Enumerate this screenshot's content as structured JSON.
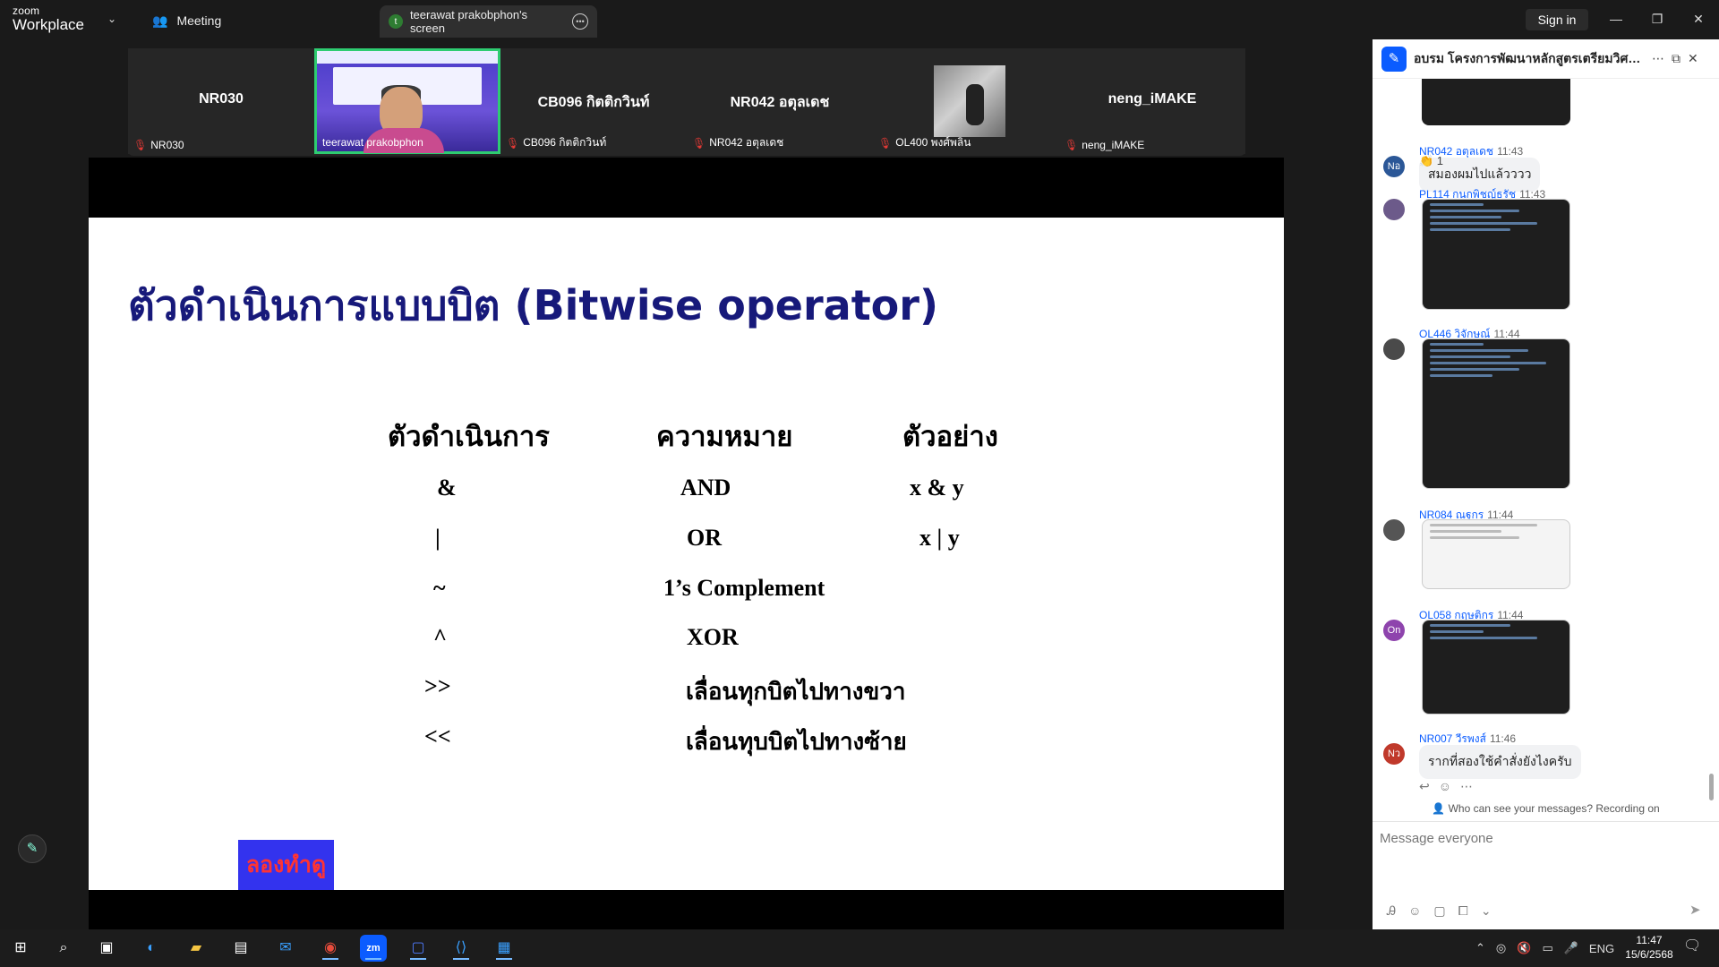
{
  "app": {
    "brand_top": "zoom",
    "brand_bottom": "Workplace",
    "meeting_label": "Meeting",
    "screen_tab": "teerawat prakobphon's screen",
    "screen_tab_initial": "t",
    "sign_in": "Sign in"
  },
  "participants": [
    {
      "big": "NR030",
      "small": "NR030"
    },
    {
      "big": "",
      "small": "teerawat prakobphon"
    },
    {
      "big": "CB096 กิตติกวินท์",
      "small": "CB096 กิตติกวินท์"
    },
    {
      "big": "NR042 อตุลเดช",
      "small": "NR042 อตุลเดช"
    },
    {
      "big": "",
      "small": "OL400 พงศ์พลิน"
    },
    {
      "big": "neng_iMAKE",
      "small": "neng_iMAKE"
    }
  ],
  "slide": {
    "title": "ตัวดำเนินการแบบบิต (Bitwise operator)",
    "headers": [
      "ตัวดำเนินการ",
      "ความหมาย",
      "ตัวอย่าง"
    ],
    "rows": [
      {
        "op": "&",
        "meaning": "AND",
        "example": "x & y"
      },
      {
        "op": "|",
        "meaning": "OR",
        "example": "x | y"
      },
      {
        "op": "~",
        "meaning": "1’s Complement",
        "example": ""
      },
      {
        "op": "^",
        "meaning": "XOR",
        "example": ""
      },
      {
        "op": ">>",
        "meaning": "เลื่อนทุกบิตไปทางขวา",
        "example": ""
      },
      {
        "op": "<<",
        "meaning": "เลื่อนทุบบิตไปทางซ้าย",
        "example": ""
      }
    ],
    "button": "ลองทำดู"
  },
  "chat": {
    "title": "อบรม โครงการพัฒนาหลักสูตรเตรียมวิศวก...",
    "messages": [
      {
        "sender": "NR042 อตุลเดช",
        "time": "11:43",
        "avatar": "Nอ",
        "avatar_color": "#2b5797",
        "text": "สมองผมไปแล้วววว",
        "reaction": "👏 1"
      },
      {
        "sender": "PL114 กนกพิชญ์ธรัช",
        "time": "11:43",
        "avatar": "",
        "avatar_color": "#6c5a8a",
        "image": true
      },
      {
        "sender": "OL446 วิจักษณ์",
        "time": "11:44",
        "avatar": "",
        "avatar_color": "#4a4a4a",
        "image": true
      },
      {
        "sender": "NR084 ณฐกร",
        "time": "11:44",
        "avatar": "",
        "avatar_color": "#555",
        "image": true
      },
      {
        "sender": "OL058 กฤษติกร",
        "time": "11:44",
        "avatar": "On",
        "avatar_color": "#8e44ad",
        "image": true
      },
      {
        "sender": "NR007 วีรพงส์",
        "time": "11:46",
        "avatar": "Nว",
        "avatar_color": "#c0392b",
        "text": "รากที่สองใช้คำสั่งยังไงครับ"
      }
    ],
    "visibility_note": "Who can see your messages? Recording on",
    "compose_placeholder": "Message everyone"
  },
  "taskbar": {
    "language": "ENG",
    "time": "11:47",
    "date": "15/6/2568"
  },
  "colors": {
    "slide_title": "#17197a",
    "active_speaker": "#2ecc71",
    "zoom_blue": "#0b5cff",
    "try_button_bg": "#3333ee",
    "try_button_text": "#ff3333"
  }
}
